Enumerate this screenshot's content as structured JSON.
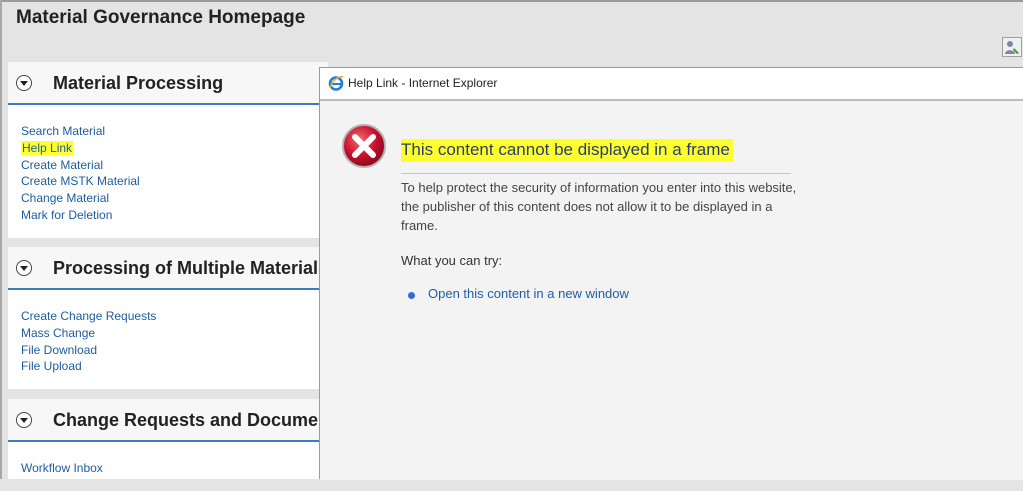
{
  "page": {
    "title": "Material Governance Homepage"
  },
  "sections": [
    {
      "title": "Material Processing",
      "links": [
        "Search Material",
        "Help Link",
        "Create Material",
        "Create MSTK Material",
        "Change Material",
        "Mark for Deletion"
      ]
    },
    {
      "title": "Processing of Multiple Materials",
      "links": [
        "Create Change Requests",
        "Mass Change",
        "File Download",
        "File Upload"
      ]
    },
    {
      "title": "Change Requests and Documents",
      "links": [
        "Workflow Inbox"
      ]
    }
  ],
  "highlight": {
    "link": "Help Link",
    "color": "#ffff33"
  },
  "dialog": {
    "title": "Help Link - Internet Explorer",
    "heading": "This content cannot be displayed in a frame",
    "body": "To help protect the security of information you enter into this website, the publisher of this content does not allow it to be displayed in a frame.",
    "try_label": "What you can try:",
    "action_link": "Open this content in a new window"
  },
  "colors": {
    "accent": "#3b7bbf",
    "link": "#1e5c9c",
    "error": "#c8102e",
    "highlight": "#ffff2e"
  }
}
